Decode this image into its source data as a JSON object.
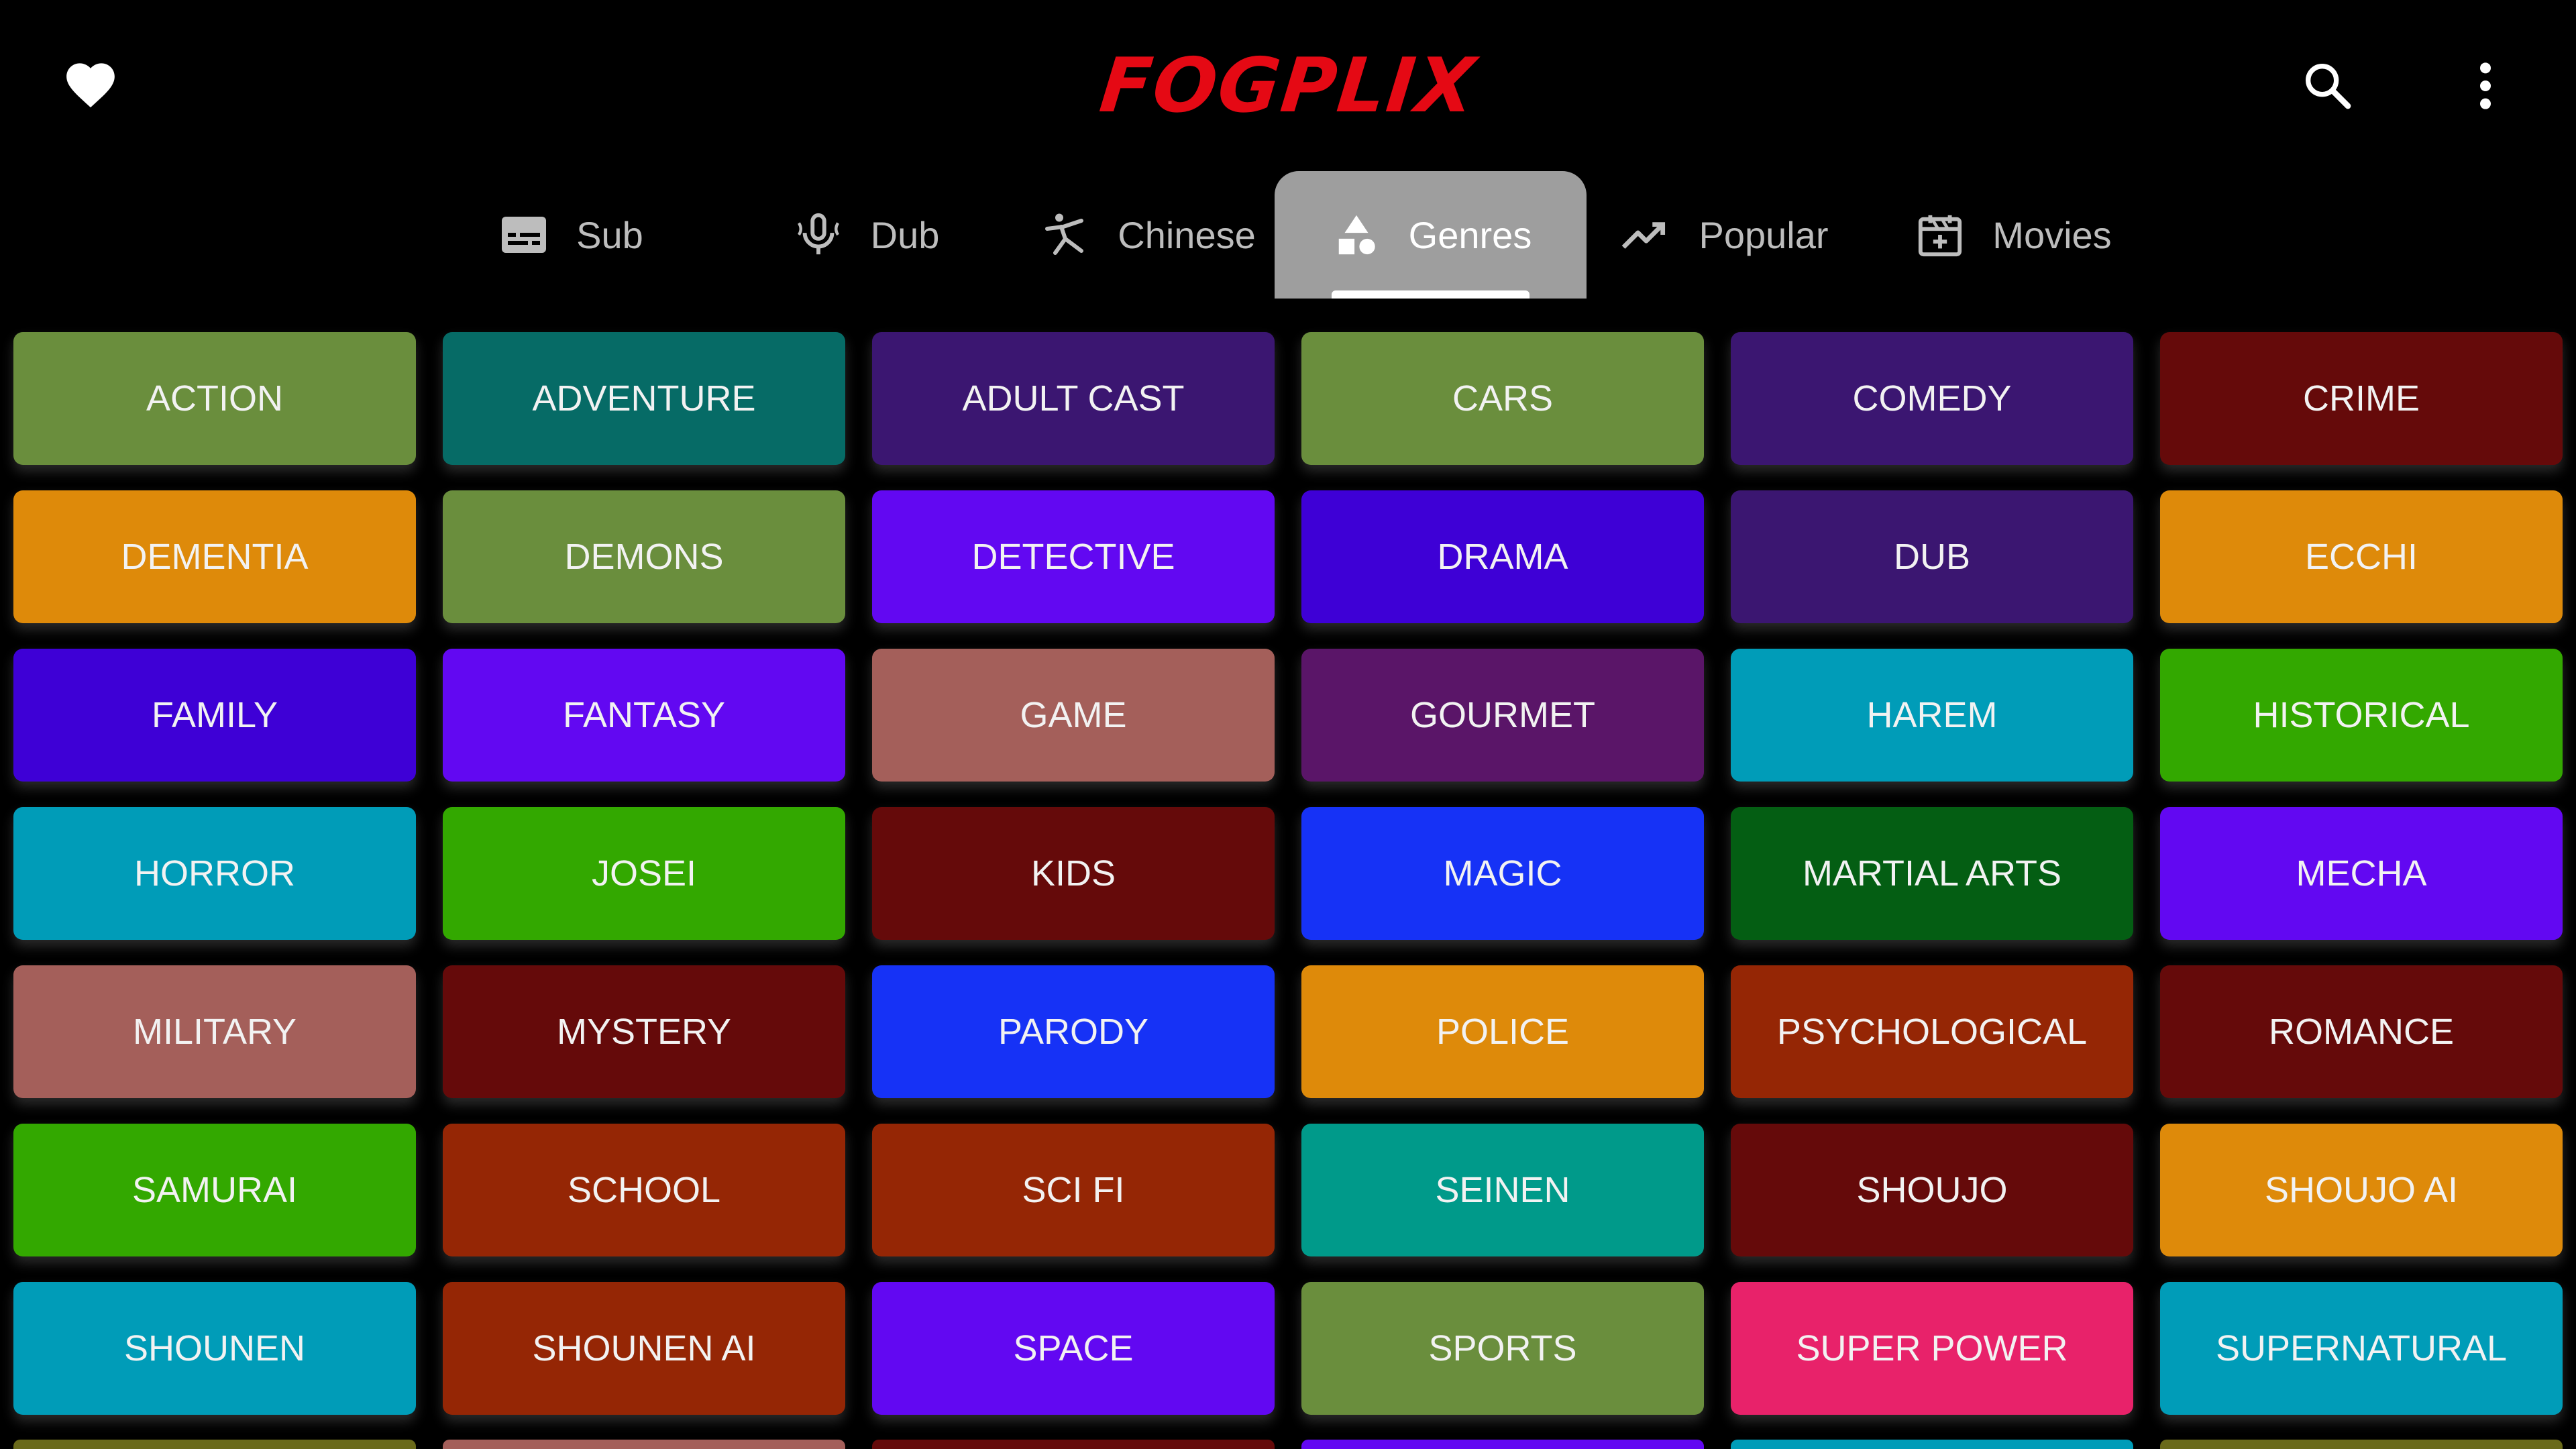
{
  "app": {
    "logo": "FOGPLIX",
    "brand_color": "#e50914",
    "icons": {
      "favorites": "heart-icon",
      "search": "search-icon",
      "menu": "more-vertical-icon"
    }
  },
  "tabs": [
    {
      "label": "Sub",
      "icon": "subtitles-icon",
      "active": false
    },
    {
      "label": "Dub",
      "icon": "microphone-icon",
      "active": false
    },
    {
      "label": "Chinese",
      "icon": "martial-arts-icon",
      "active": false
    },
    {
      "label": "Genres",
      "icon": "shapes-icon",
      "active": true
    },
    {
      "label": "Popular",
      "icon": "trending-up-icon",
      "active": false
    },
    {
      "label": "Movies",
      "icon": "movie-calendar-icon",
      "active": false
    }
  ],
  "genres": [
    {
      "label": "ACTION",
      "color": "#6a8e3d"
    },
    {
      "label": "ADVENTURE",
      "color": "#066b66"
    },
    {
      "label": "ADULT CAST",
      "color": "#3b1671"
    },
    {
      "label": "CARS",
      "color": "#6a8e3d"
    },
    {
      "label": "COMEDY",
      "color": "#3b1671"
    },
    {
      "label": "CRIME",
      "color": "#650a0a"
    },
    {
      "label": "DEMENTIA",
      "color": "#de8a0a"
    },
    {
      "label": "DEMONS",
      "color": "#6a8e3d"
    },
    {
      "label": "DETECTIVE",
      "color": "#6208f2"
    },
    {
      "label": "DRAMA",
      "color": "#3e00d6"
    },
    {
      "label": "DUB",
      "color": "#3b1671"
    },
    {
      "label": "ECCHI",
      "color": "#de8a0a"
    },
    {
      "label": "FAMILY",
      "color": "#3e00d6"
    },
    {
      "label": "FANTASY",
      "color": "#6208f2"
    },
    {
      "label": "GAME",
      "color": "#a45f5a"
    },
    {
      "label": "GOURMET",
      "color": "#5a1568"
    },
    {
      "label": "HAREM",
      "color": "#009cb8"
    },
    {
      "label": "HISTORICAL",
      "color": "#33a800"
    },
    {
      "label": "HORROR",
      "color": "#009cb8"
    },
    {
      "label": "JOSEI",
      "color": "#33a800"
    },
    {
      "label": "KIDS",
      "color": "#650a0a"
    },
    {
      "label": "MAGIC",
      "color": "#1632f6"
    },
    {
      "label": "MARTIAL ARTS",
      "color": "#045e13"
    },
    {
      "label": "MECHA",
      "color": "#6208f2"
    },
    {
      "label": "MILITARY",
      "color": "#a45f5a"
    },
    {
      "label": "MYSTERY",
      "color": "#650a0a"
    },
    {
      "label": "PARODY",
      "color": "#1632f6"
    },
    {
      "label": "POLICE",
      "color": "#de8a0a"
    },
    {
      "label": "PSYCHOLOGICAL",
      "color": "#952605"
    },
    {
      "label": "ROMANCE",
      "color": "#650a0a"
    },
    {
      "label": "SAMURAI",
      "color": "#33a800"
    },
    {
      "label": "SCHOOL",
      "color": "#952605"
    },
    {
      "label": "SCI FI",
      "color": "#952605"
    },
    {
      "label": "SEINEN",
      "color": "#009a8a"
    },
    {
      "label": "SHOUJO",
      "color": "#650a0a"
    },
    {
      "label": "SHOUJO AI",
      "color": "#de8a0a"
    },
    {
      "label": "SHOUNEN",
      "color": "#009cb8"
    },
    {
      "label": "SHOUNEN AI",
      "color": "#952605"
    },
    {
      "label": "SPACE",
      "color": "#6208f2"
    },
    {
      "label": "SPORTS",
      "color": "#6a8e3d"
    },
    {
      "label": "SUPER POWER",
      "color": "#e8226a"
    },
    {
      "label": "SUPERNATURAL",
      "color": "#009cb8"
    }
  ],
  "partial_row_colors": [
    "#6a6a1a",
    "#a45f5a",
    "#650a0a",
    "#6208f2",
    "#009cb8",
    "#6a6a1a"
  ]
}
